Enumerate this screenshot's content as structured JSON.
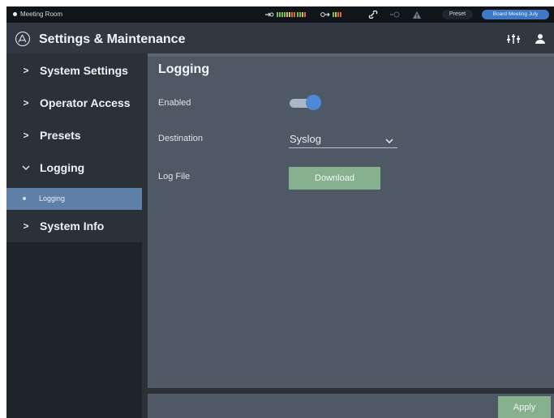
{
  "status_bar": {
    "room_name": "Meeting Room",
    "preset_label": "Preset",
    "current_preset": "Board Meeting July"
  },
  "header": {
    "title": "Settings & Maintenance",
    "logo_icon": "brand-logo-icon",
    "right_icons": [
      "mixer-settings-icon",
      "user-icon"
    ]
  },
  "sidebar": {
    "items": [
      {
        "label": "System Settings",
        "expanded": false
      },
      {
        "label": "Operator Access",
        "expanded": false
      },
      {
        "label": "Presets",
        "expanded": false
      },
      {
        "label": "Logging",
        "expanded": true
      },
      {
        "label": "System Info",
        "expanded": false
      }
    ],
    "active_sub_item": "Logging"
  },
  "main": {
    "section_title": "Logging",
    "enabled_label": "Enabled",
    "enabled_value": true,
    "destination_label": "Destination",
    "destination_value": "Syslog",
    "log_file_label": "Log File",
    "download_label": "Download"
  },
  "footer": {
    "apply_label": "Apply"
  },
  "colors": {
    "status_bar_bg": "#111419",
    "header_bg": "#313841",
    "sidebar_bg": "#2a3138",
    "sidebar_active": "#5d7fa8",
    "main_bg": "#4f5865",
    "toggle_on": "#4d89d6",
    "button_green": "#86b08e",
    "preset_blue": "#3f78c5"
  }
}
